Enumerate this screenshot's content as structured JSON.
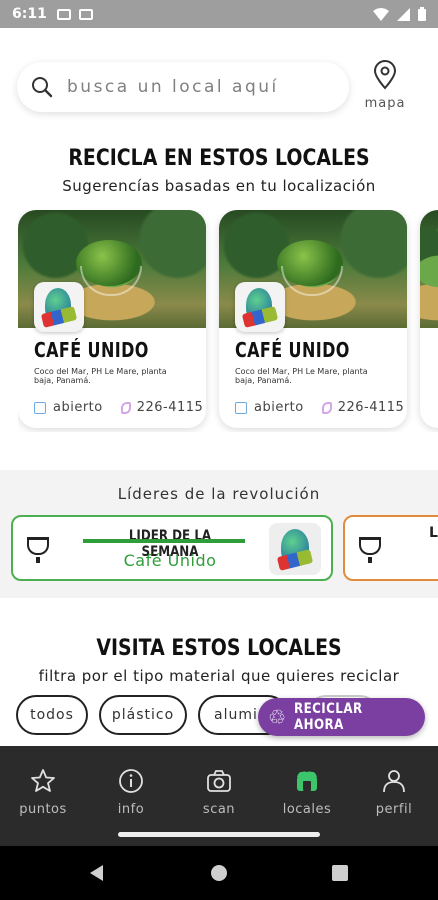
{
  "status_bar": {
    "time": "6:11"
  },
  "search": {
    "placeholder": "busca un local aquí",
    "map_label": "mapa"
  },
  "recycle_section": {
    "title": "RECICLA EN ESTOS LOCALES",
    "subtitle": "Sugerencías basadas en tu localización",
    "cards": [
      {
        "name": "CAFÉ UNIDO",
        "address": "Coco del Mar, PH Le Mare, planta baja, Panamá.",
        "status": "abierto",
        "phone": "226-4115"
      },
      {
        "name": "CAFÉ UNIDO",
        "address": "Coco del Mar, PH Le Mare, planta baja, Panamá.",
        "status": "abierto",
        "phone": "226-4115"
      }
    ]
  },
  "leaders": {
    "title": "Líderes de la revolución",
    "week_label": "LIDER DE LA SEMANA",
    "winner": "Café Unido",
    "second_peek": "L"
  },
  "visit_section": {
    "title": "VISITA ESTOS LOCALES",
    "subtitle": "filtra por el tipo material que quieres reciclar",
    "chips": [
      "todos",
      "plástico",
      "alumin"
    ]
  },
  "fab": {
    "label": "RECICLAR AHORA",
    "color": "#7a3fa0"
  },
  "bottom_nav": {
    "items": [
      {
        "label": "puntos",
        "icon": "star-icon"
      },
      {
        "label": "info",
        "icon": "info-icon"
      },
      {
        "label": "scan",
        "icon": "camera-icon"
      },
      {
        "label": "locales",
        "icon": "store-icon"
      },
      {
        "label": "perfil",
        "icon": "person-icon"
      }
    ],
    "active": "locales",
    "active_color": "#3cc56b"
  }
}
